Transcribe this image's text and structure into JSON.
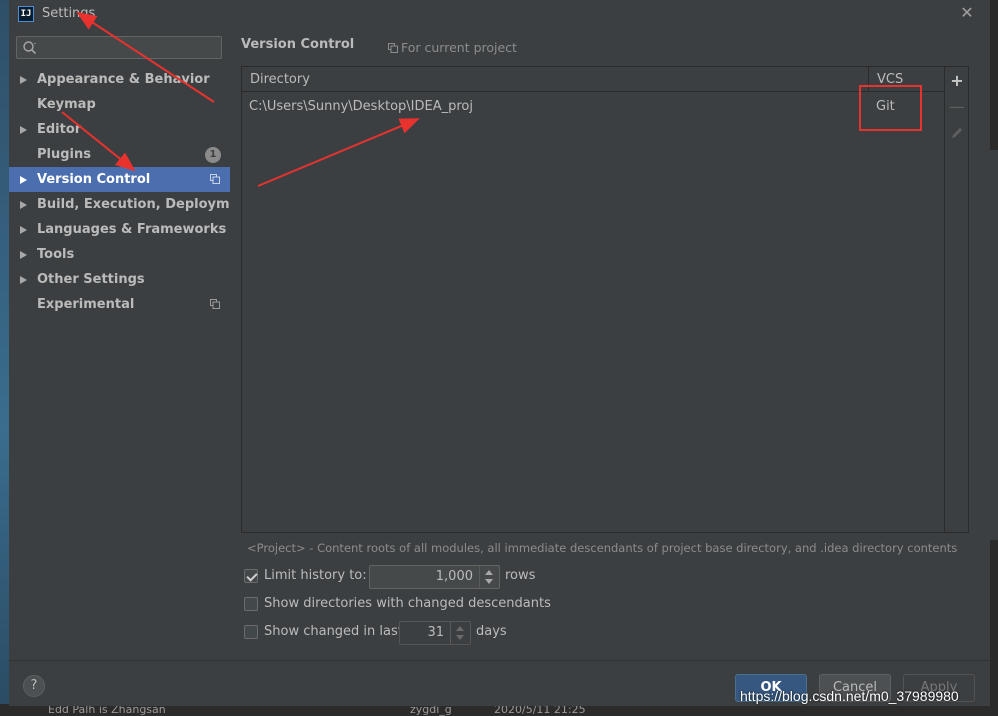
{
  "window": {
    "title": "Settings",
    "app_icon": "IJ"
  },
  "search": {
    "placeholder": ""
  },
  "sidebar": {
    "items": [
      {
        "label": "Appearance & Behavior",
        "expandable": true
      },
      {
        "label": "Keymap",
        "expandable": false
      },
      {
        "label": "Editor",
        "expandable": true
      },
      {
        "label": "Plugins",
        "expandable": false,
        "badge": "1"
      },
      {
        "label": "Version Control",
        "expandable": true,
        "selected": true
      },
      {
        "label": "Build, Execution, Deployment",
        "expandable": true
      },
      {
        "label": "Languages & Frameworks",
        "expandable": true
      },
      {
        "label": "Tools",
        "expandable": true
      },
      {
        "label": "Other Settings",
        "expandable": true
      },
      {
        "label": "Experimental",
        "expandable": false
      }
    ]
  },
  "main": {
    "title": "Version Control",
    "scope": "For current project",
    "table": {
      "headers": {
        "directory": "Directory",
        "vcs": "VCS"
      },
      "rows": [
        {
          "directory": "C:\\Users\\Sunny\\Desktop\\IDEA_proj",
          "vcs": "Git"
        }
      ]
    },
    "hint": "<Project> - Content roots of all modules, all immediate descendants of project base directory, and .idea directory contents",
    "options": {
      "limit_history": {
        "label": "Limit history to:",
        "checked": true,
        "value": "1,000",
        "suffix": "rows"
      },
      "show_dirs": {
        "label": "Show directories with changed descendants",
        "checked": false
      },
      "show_changed": {
        "label": "Show changed in last",
        "checked": false,
        "value": "31",
        "suffix": "days"
      }
    }
  },
  "buttons": {
    "help": "?",
    "ok": "OK",
    "cancel": "Cancel",
    "apply": "Apply"
  },
  "background": {
    "left_text": "Edd Palh is Zhangsan",
    "mid_text": "zygdi_g",
    "date_text": "2020/5/11 21:25"
  },
  "watermark": "https://blog.csdn.net/m0_37989980",
  "colors": {
    "selection": "#4b6eaf",
    "annotation": "#e8322e",
    "ok_button": "#365880"
  }
}
